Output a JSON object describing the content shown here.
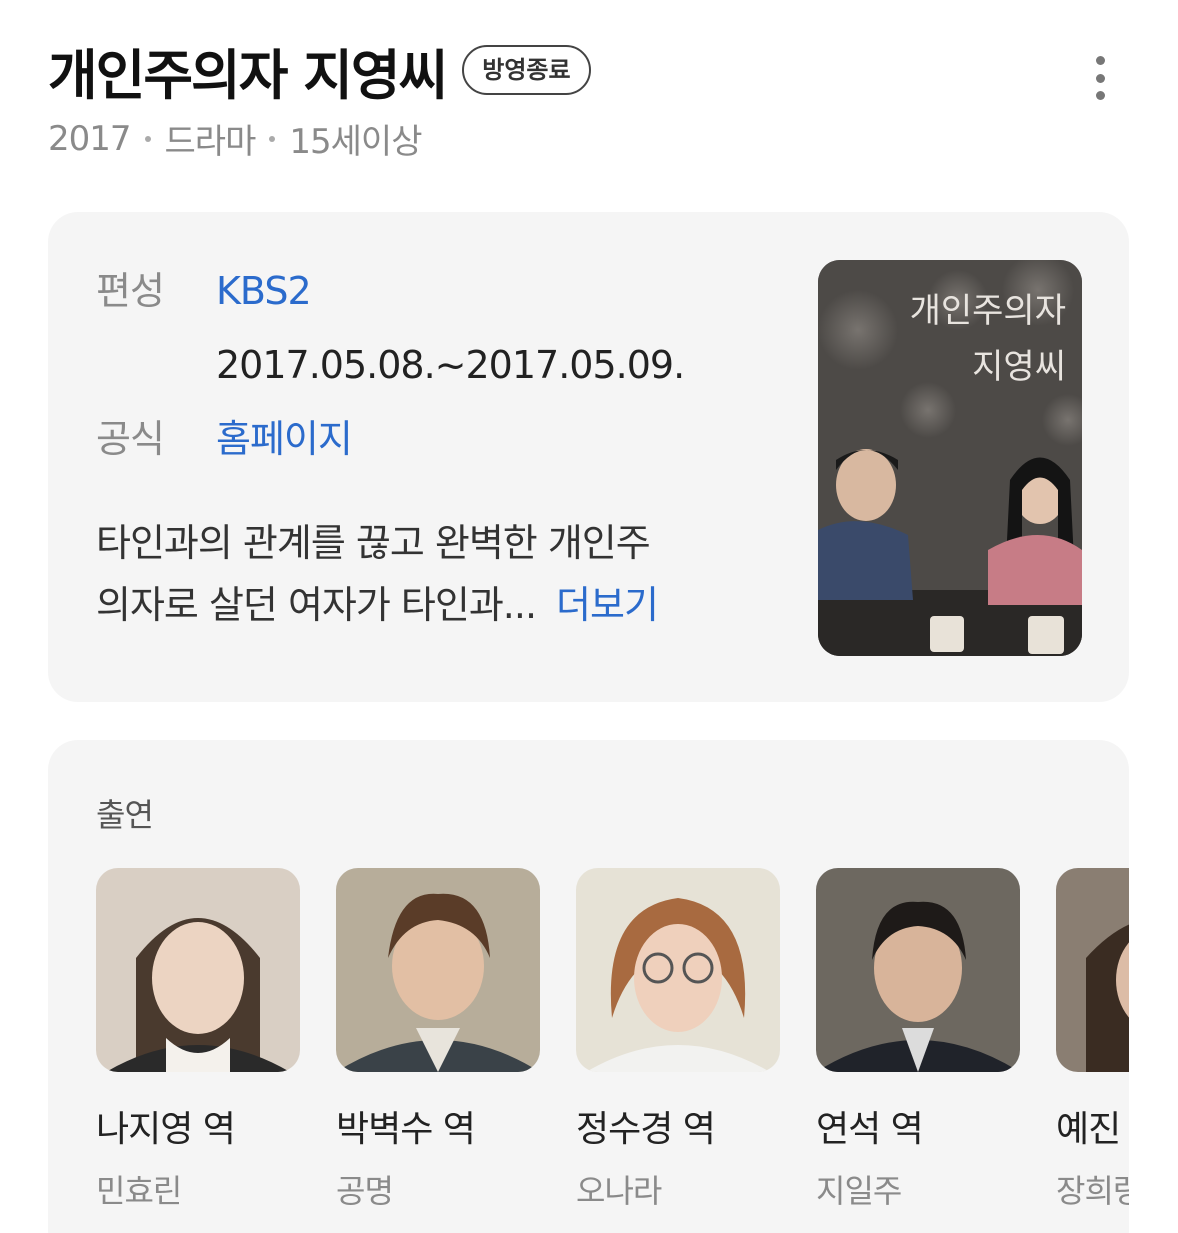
{
  "header": {
    "title": "개인주의자 지영씨",
    "status_badge": "방영종료",
    "meta": {
      "year": "2017",
      "genre": "드라마",
      "rating": "15세이상"
    }
  },
  "info": {
    "broadcast_label": "편성",
    "broadcast_channel": "KBS2",
    "air_dates": "2017.05.08.~2017.05.09.",
    "official_label": "공식",
    "official_link": "홈페이지",
    "synopsis_line1": "타인과의 관계를 끊고 완벽한 개인주",
    "synopsis_line2": "의자로 살던 여자가 타인과...",
    "more_label": "더보기",
    "poster_text_line1": "개인주의자",
    "poster_text_line2": "지영씨"
  },
  "cast": {
    "heading": "출연",
    "members": [
      {
        "role": "나지영 역",
        "actor": "민효린"
      },
      {
        "role": "박벽수 역",
        "actor": "공명"
      },
      {
        "role": "정수경 역",
        "actor": "오나라"
      },
      {
        "role": "연석 역",
        "actor": "지일주"
      },
      {
        "role": "예진",
        "actor": "장희령"
      }
    ]
  },
  "colors": {
    "link": "#2b6bcc",
    "card_background": "#f5f5f5",
    "muted_text": "#8a8a8a"
  }
}
